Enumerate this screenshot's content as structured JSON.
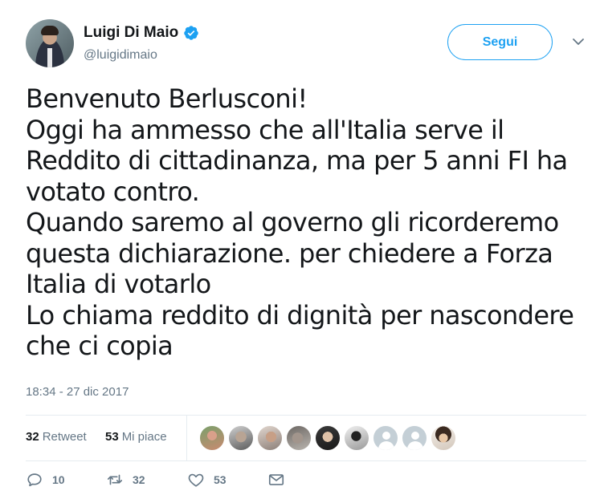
{
  "header": {
    "display_name": "Luigi Di Maio",
    "handle": "@luigidimaio",
    "verified": true,
    "follow_label": "Segui"
  },
  "tweet": {
    "lines": [
      "Benvenuto Berlusconi!",
      "Oggi ha ammesso che all'Italia serve il",
      "Reddito di cittadinanza, ma per 5 anni FI ha",
      "votato contro.",
      "Quando saremo al governo gli ricorderemo",
      "questa dichiarazione. per chiedere a Forza",
      "Italia di votarlo",
      "Lo chiama reddito di dignità per nascondere",
      "che ci copia"
    ],
    "timestamp": "18:34 - 27 dic 2017"
  },
  "stats": {
    "retweet_count": "32",
    "retweet_label": "Retweet",
    "like_count": "53",
    "like_label": "Mi piace",
    "liker_avatars": [
      "photo",
      "photo",
      "photo",
      "photo",
      "photo",
      "photo",
      "default",
      "default",
      "photo"
    ]
  },
  "actions": {
    "reply_count": "10",
    "retweet_count": "32",
    "like_count": "53"
  },
  "colors": {
    "accent": "#1da1f2",
    "text": "#14171a",
    "secondary": "#657786",
    "divider": "#e6ecf0"
  },
  "icons": {
    "verified": "verified-badge-icon",
    "chevron": "chevron-down-icon",
    "reply": "reply-icon",
    "retweet": "retweet-icon",
    "like": "heart-icon",
    "dm": "envelope-icon"
  }
}
